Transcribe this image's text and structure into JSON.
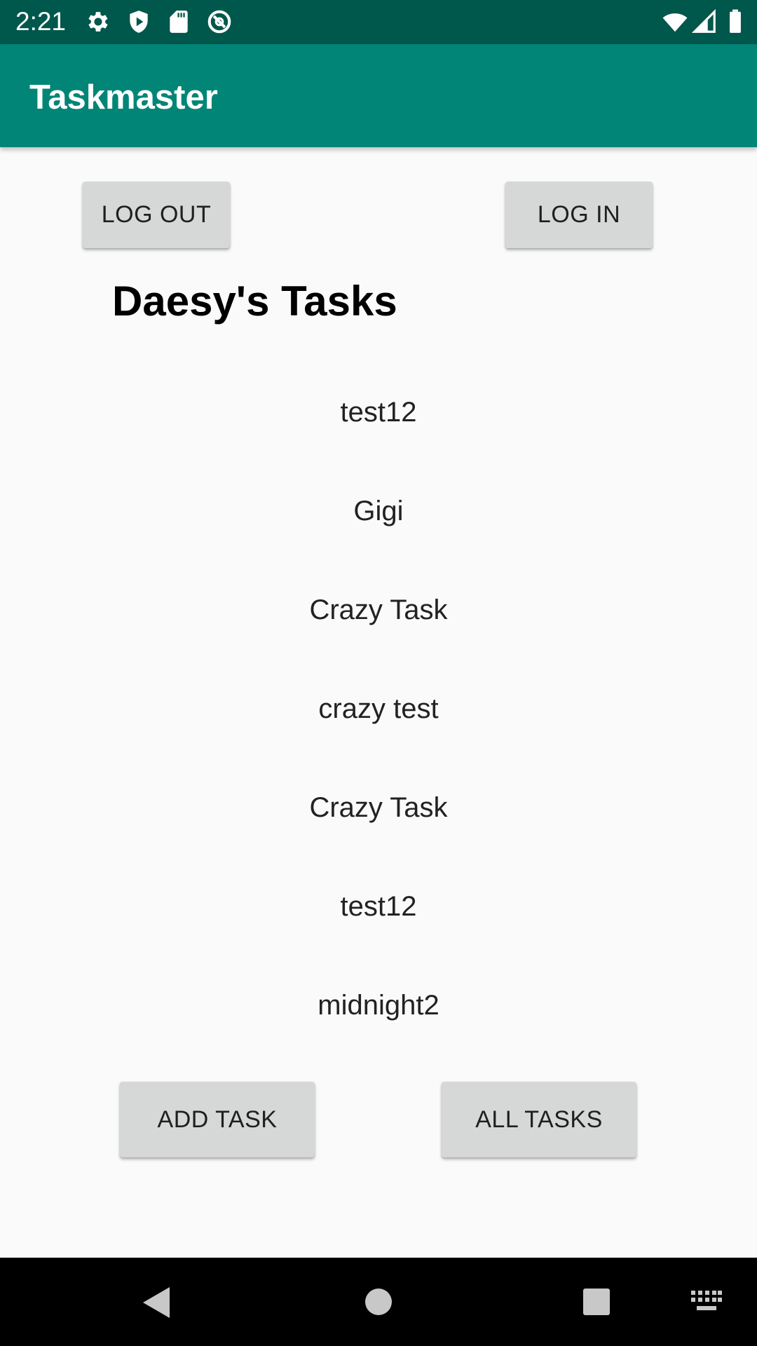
{
  "status_bar": {
    "time": "2:21",
    "left_icons": [
      "settings-icon",
      "shield-icon",
      "sd-card-icon",
      "do-not-disturb-icon"
    ],
    "right_icons": [
      "wifi-icon",
      "cell-signal-icon",
      "battery-icon"
    ]
  },
  "app_bar": {
    "title": "Taskmaster",
    "color": "#008577",
    "status_color": "#00574b"
  },
  "auth": {
    "logout_label": "LOG OUT",
    "login_label": "LOG IN"
  },
  "heading": "Daesy's Tasks",
  "tasks": [
    "test12",
    "Gigi",
    "Crazy Task",
    "crazy test",
    "Crazy Task",
    "test12",
    "midnight2"
  ],
  "actions": {
    "add_task_label": "ADD TASK",
    "all_tasks_label": "ALL TASKS"
  },
  "nav_bar": {
    "icons": [
      "back-icon",
      "home-icon",
      "recents-icon",
      "keyboard-icon"
    ]
  }
}
